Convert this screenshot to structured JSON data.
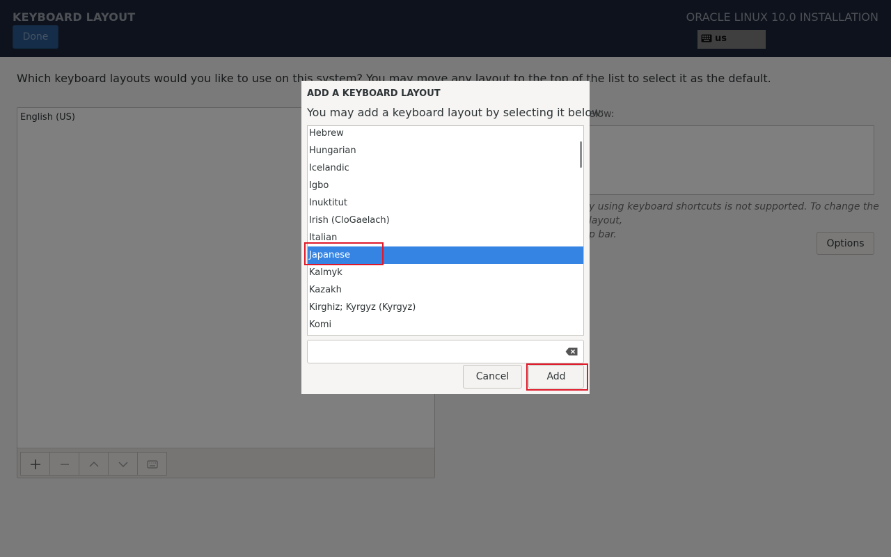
{
  "header": {
    "title": "KEYBOARD LAYOUT",
    "done_label": "Done",
    "product": "ORACLE LINUX 10.0 INSTALLATION",
    "keyboard_indicator": "us",
    "keyboard_icon": "keyboard-icon",
    "accent_color": "#1c2538"
  },
  "main": {
    "instruction": "Which keyboard layouts would you like to use on this system?  You may move any layout to the top of the list to select it as the default.",
    "layouts": [
      "English (US)"
    ],
    "toolbar_icons": [
      "plus-icon",
      "minus-icon",
      "chevron-up-icon",
      "chevron-down-icon",
      "keyboard-icon"
    ],
    "right_label": "elow:",
    "note_line1": "y using keyboard shortcuts is not supported. To change the layout,",
    "note_line2": "p bar.",
    "options_label": "Options"
  },
  "dialog": {
    "title": "ADD A KEYBOARD LAYOUT",
    "subtitle": "You may add a keyboard layout by selecting it below:",
    "items": [
      "Hebrew",
      "Hungarian",
      "Icelandic",
      "Igbo",
      "Inuktitut",
      "Irish (CloGaelach)",
      "Italian",
      "Japanese",
      "Kalmyk",
      "Kazakh",
      "Kirghiz; Kyrgyz (Kyrgyz)",
      "Komi"
    ],
    "selected": "Japanese",
    "search_value": "",
    "cancel_label": "Cancel",
    "add_label": "Add",
    "selection_color": "#3584e4",
    "highlight_color": "#e0192a"
  }
}
